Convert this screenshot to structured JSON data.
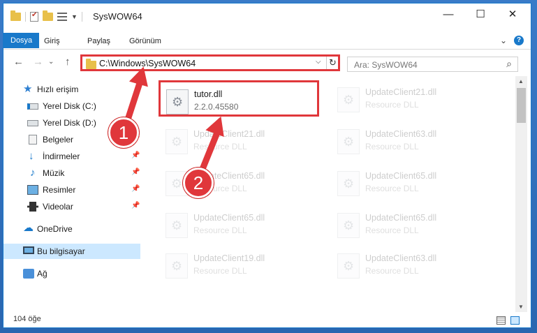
{
  "window": {
    "title": "SysWOW64",
    "controls": {
      "minimize": "—",
      "maximize": "☐",
      "close": "✕"
    }
  },
  "ribbon": {
    "tabs": [
      "Dosya",
      "Giriş",
      "Paylaş",
      "Görünüm"
    ],
    "expand_icon": "chevron-down",
    "help_icon": "?"
  },
  "address": {
    "path": "C:\\Windows\\SysWOW64",
    "dropdown_icon": "⌵",
    "refresh_icon": "↻"
  },
  "search": {
    "placeholder": "Ara: SysWOW64",
    "icon": "⌕"
  },
  "nav_buttons": {
    "back": "←",
    "forward": "→",
    "recent": "⌄",
    "up": "↑"
  },
  "sidebar": {
    "items": [
      {
        "label": "Hızlı erişim",
        "icon": "star-icon",
        "pinned": false
      },
      {
        "label": "Yerel Disk (C:)",
        "icon": "drive-icon",
        "pinned": true
      },
      {
        "label": "Yerel Disk (D:)",
        "icon": "drive-icon",
        "pinned": true
      },
      {
        "label": "Belgeler",
        "icon": "document-icon",
        "pinned": true
      },
      {
        "label": "İndirmeler",
        "icon": "download-icon",
        "pinned": true
      },
      {
        "label": "Müzik",
        "icon": "music-icon",
        "pinned": true
      },
      {
        "label": "Resimler",
        "icon": "pictures-icon",
        "pinned": true
      },
      {
        "label": "Videolar",
        "icon": "video-icon",
        "pinned": true
      },
      {
        "label": "OneDrive",
        "icon": "cloud-icon",
        "pinned": false
      },
      {
        "label": "Bu bilgisayar",
        "icon": "computer-icon",
        "selected": true
      },
      {
        "label": "Ağ",
        "icon": "network-icon",
        "pinned": false
      }
    ],
    "pin_glyph": "📌"
  },
  "files": [
    {
      "name": "tutor.dll",
      "desc": "2.2.0.45580",
      "highlighted": true
    },
    {
      "name": "UpdateClient21.dll",
      "desc": "Resource DLL"
    },
    {
      "name": "UpdateClient21.dll",
      "desc": "Resource DLL"
    },
    {
      "name": "UpdateClient63.dll",
      "desc": "Resource DLL"
    },
    {
      "name": "UpdateClient65.dll",
      "desc": "Resource DLL"
    },
    {
      "name": "UpdateClient65.dll",
      "desc": "Resource DLL"
    },
    {
      "name": "UpdateClient65.dll",
      "desc": "Resource DLL"
    },
    {
      "name": "UpdateClient65.dll",
      "desc": "Resource DLL"
    },
    {
      "name": "UpdateClient19.dll",
      "desc": "Resource DLL"
    },
    {
      "name": "UpdateClient63.dll",
      "desc": "Resource DLL"
    }
  ],
  "status": {
    "item_count": "104 öğe"
  },
  "annotations": {
    "badge1": "1",
    "badge2": "2",
    "color": "#e0373b"
  }
}
